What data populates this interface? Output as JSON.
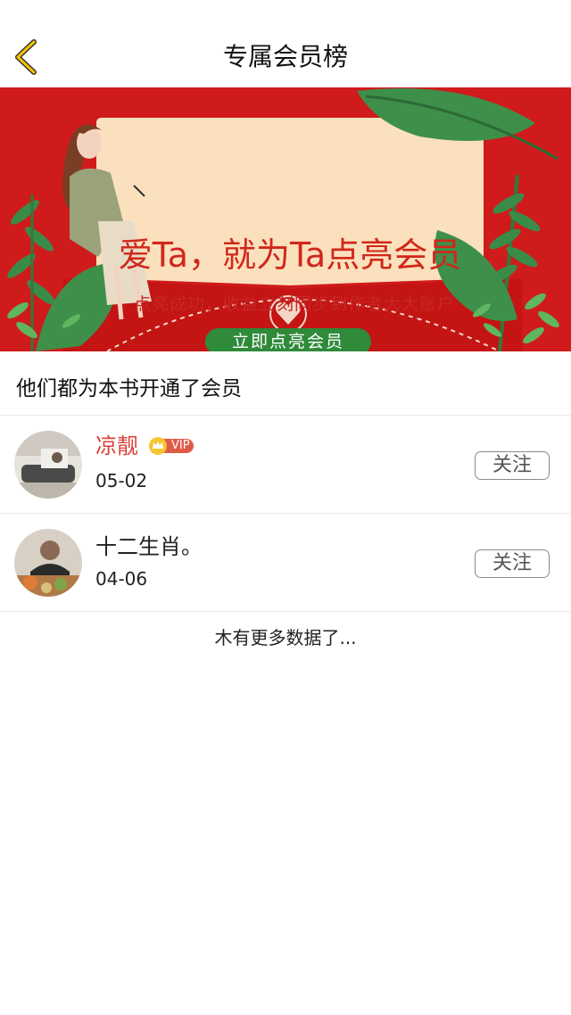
{
  "header": {
    "title": "专属会员榜"
  },
  "banner": {
    "headline": "爱Ta，就为Ta点亮会员",
    "subtitle": "点亮成功，收益立刻同步到作者大大账户",
    "cta_label": "立即点亮会员"
  },
  "section": {
    "title": "他们都为本书开通了会员"
  },
  "members": [
    {
      "name": "凉靓",
      "date": "05-02",
      "vip": true,
      "vip_label": "VIP",
      "follow_label": "关注",
      "name_color": "#d9433a"
    },
    {
      "name": "十二生肖。",
      "date": "04-06",
      "vip": false,
      "follow_label": "关注",
      "name_color": "#222222"
    }
  ],
  "footer": {
    "no_more_text": "木有更多数据了..."
  },
  "colors": {
    "accent": "#f5c400",
    "banner_red": "#cf1b1b",
    "cta_green": "#2f8a3a",
    "vip_red": "#d9433a"
  }
}
